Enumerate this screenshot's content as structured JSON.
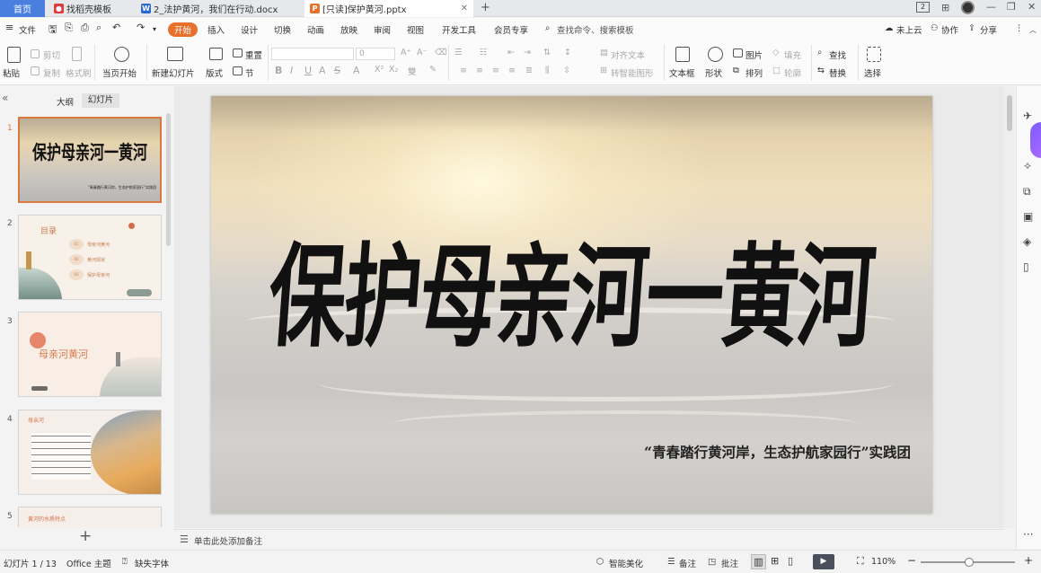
{
  "tabs": {
    "home": "首页",
    "template": "找稻壳模板",
    "docx": "2_法护黄河，我们在行动.docx",
    "pptx": "[只读]保护黄河.pptx"
  },
  "menu": {
    "file": "文件",
    "items": [
      "开始",
      "插入",
      "设计",
      "切换",
      "动画",
      "放映",
      "审阅",
      "视图",
      "开发工具",
      "会员专享"
    ],
    "search": "查找命令、搜索模板",
    "cloud": "未上云",
    "collab": "协作",
    "share": "分享"
  },
  "ribbon": {
    "paste": "粘贴",
    "cut": "剪切",
    "copy": "复制",
    "format_painter": "格式刷",
    "from_current": "当页开始",
    "new_slide": "新建幻灯片",
    "layout": "版式",
    "reset": "重置",
    "section": "节",
    "font_size": "0",
    "to_smartart": "转智能图形",
    "text_box": "文本框",
    "shape": "形状",
    "picture": "图片",
    "arrange": "排列",
    "fill": "填充",
    "outline": "轮廓",
    "find": "查找",
    "replace": "替换",
    "select": "选择",
    "align_text": "对齐文本"
  },
  "left_panel": {
    "tab_outline": "大纲",
    "tab_slides": "幻灯片",
    "slide_numbers": [
      "1",
      "2",
      "3",
      "4",
      "5"
    ],
    "thumb1_title": "保护母亲河一黄河",
    "thumb1_sub": "“青春踏行黄河岸，生态护航家园行”实践团",
    "thumb2_title": "目录",
    "thumb2_items": [
      "母亲河黄河",
      "黄河现状",
      "保护母亲河"
    ],
    "thumb2_nums": [
      "01",
      "02",
      "03"
    ],
    "thumb3_title": "母亲河黄河",
    "thumb4_title": "母亲河",
    "thumb5_title": "黄河的水质特点"
  },
  "slide": {
    "title": "保护母亲河一黄河",
    "subtitle": "“青春踏行黄河岸，生态护航家园行”实践团"
  },
  "notes_placeholder": "单击此处添加备注",
  "status": {
    "slide_counter": "幻灯片 1 / 13",
    "theme": "Office 主题",
    "missing_font": "缺失字体",
    "smart_beautify": "智能美化",
    "notes": "备注",
    "comments": "批注",
    "zoom": "110%"
  },
  "colors": {
    "accent": "#e8702d",
    "home_tab": "#4a7fe0",
    "selected_thumb_border": "#d9793e"
  }
}
